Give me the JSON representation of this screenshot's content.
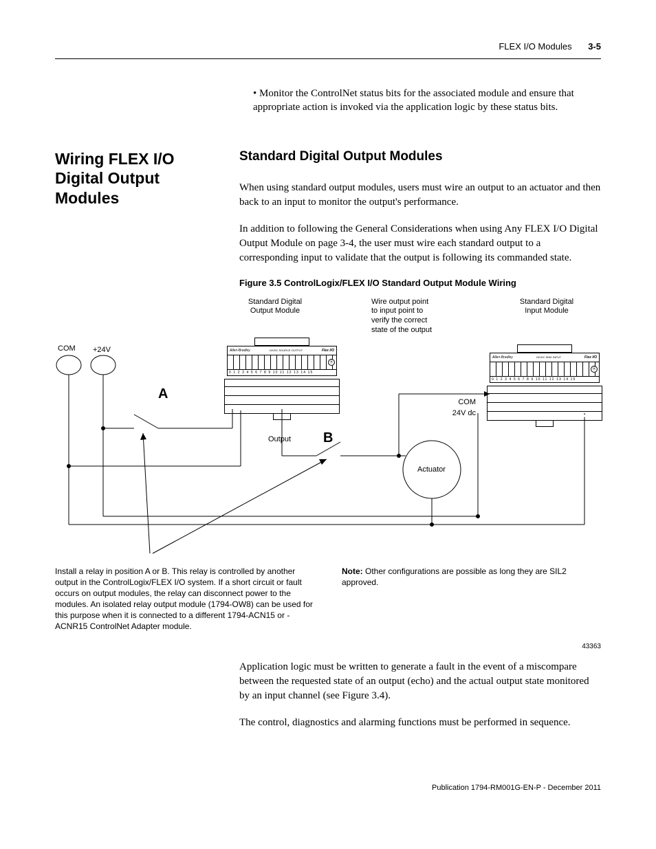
{
  "header": {
    "title": "FLEX I/O Modules",
    "page": "3-5"
  },
  "bullet": "Monitor the ControlNet status bits for the associated module and ensure that appropriate action is invoked via the application logic by these status bits.",
  "left_title": "Wiring FLEX I/O Digital Output Modules",
  "right_title": "Standard Digital Output Modules",
  "para1": "When using standard output modules, users must wire an output to an actuator and then back to an input to monitor the output's performance.",
  "para2": "In addition to following the General Considerations when using Any FLEX I/O Digital Output Module on page 3-4, the user must wire each standard output to a corresponding input to validate that the output is following its commanded state.",
  "fig_caption": "Figure 3.5  ControlLogix/FLEX I/O Standard Output Module Wiring",
  "fig": {
    "out_module_label": "Standard Digital\nOutput Module",
    "in_module_label": "Standard Digital\nInput Module",
    "wire_label": "Wire output point\nto input point to\nverify the correct\nstate of the output",
    "com": "COM",
    "v24": "+24V",
    "A": "A",
    "B": "B",
    "output": "Output",
    "actuator": "Actuator",
    "com2": "COM",
    "v24dc": "24V dc",
    "numbers": "0  1  2  3  4  5  6  7  8  9 10 11 12 13 14 15",
    "brand": "Allen-Bradley",
    "flex": "Flex I/O",
    "src": "24VDC SOURCE OUTPUT",
    "sink": "24VDC SINK INPUT"
  },
  "note_left": "Install a relay in position A or B. This relay is controlled by another output in the ControlLogix/FLEX I/O system. If a short circuit or fault occurs on output modules, the relay can disconnect power to the modules. An isolated relay output module (1794-OW8) can be used for this purpose when it is connected to a different 1794-ACN15 or -ACNR15 ControlNet Adapter module.",
  "note_right_bold": "Note:",
  "note_right": " Other configurations are possible as long they are SIL2 approved.",
  "fig_id": "43363",
  "closing1": "Application logic must be written to generate a fault in the event of a miscompare between the requested state of an output (echo) and the actual output state monitored by an input channel (see Figure 3.4).",
  "closing2": "The control, diagnostics and alarming functions must be performed in sequence.",
  "footer": "Publication 1794-RM001G-EN-P - December 2011"
}
